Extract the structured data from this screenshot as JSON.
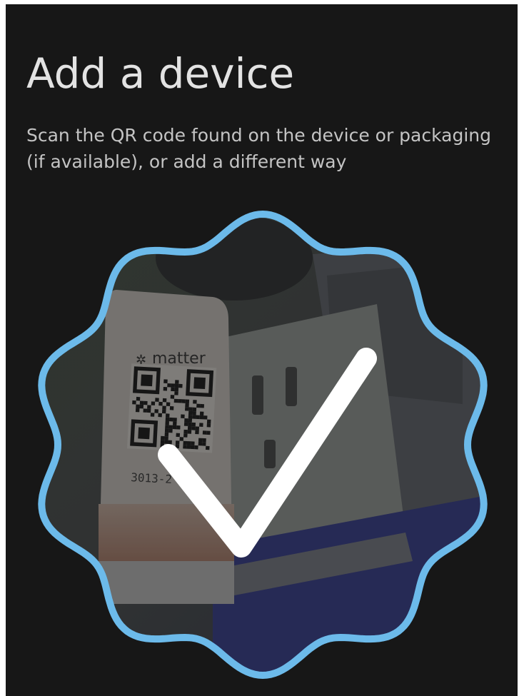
{
  "header": {
    "title": "Add a device",
    "subtitle": "Scan the QR code found on the device or packaging (if available), or add a different way"
  },
  "scanner": {
    "badge_label": "matter",
    "code_text": "3013-2",
    "status_icon": "checkmark-icon",
    "frame_shape": "scalloped-badge",
    "state": "scan-success"
  },
  "colors": {
    "background": "#171717",
    "frame": "#6cbaea",
    "title": "#e3e3e3",
    "subtitle": "#c4c4c4",
    "check": "#ffffff"
  }
}
